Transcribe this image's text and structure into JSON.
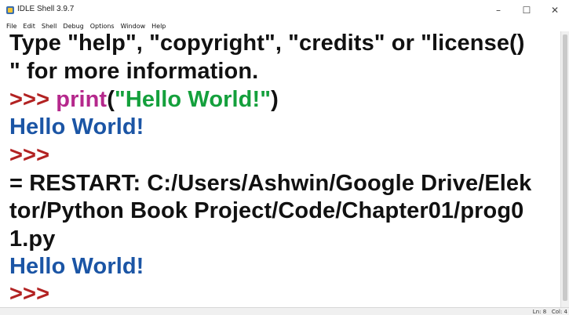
{
  "window": {
    "title": "IDLE Shell 3.9.7",
    "minimize": "–",
    "maximize": "☐",
    "close": "✕"
  },
  "menu": [
    "File",
    "Edit",
    "Shell",
    "Debug",
    "Options",
    "Window",
    "Help"
  ],
  "shell": {
    "line1": "Type \"help\", \"copyright\", \"credits\" or \"license()",
    "line2": "\" for more information.",
    "line3_prompt": ">>> ",
    "line3_builtin": "print",
    "line3_open": "(",
    "line3_string": "\"Hello World!\"",
    "line3_close": ")",
    "line4": "Hello World!",
    "line5": ">>>",
    "line6": "= RESTART: C:/Users/Ashwin/Google Drive/Elek",
    "line7": "tor/Python Book Project/Code/Chapter01/prog0",
    "line8": "1.py",
    "line9": "Hello World!",
    "line10": ">>>"
  },
  "status": {
    "position": "Ln: 8   Col: 4"
  }
}
